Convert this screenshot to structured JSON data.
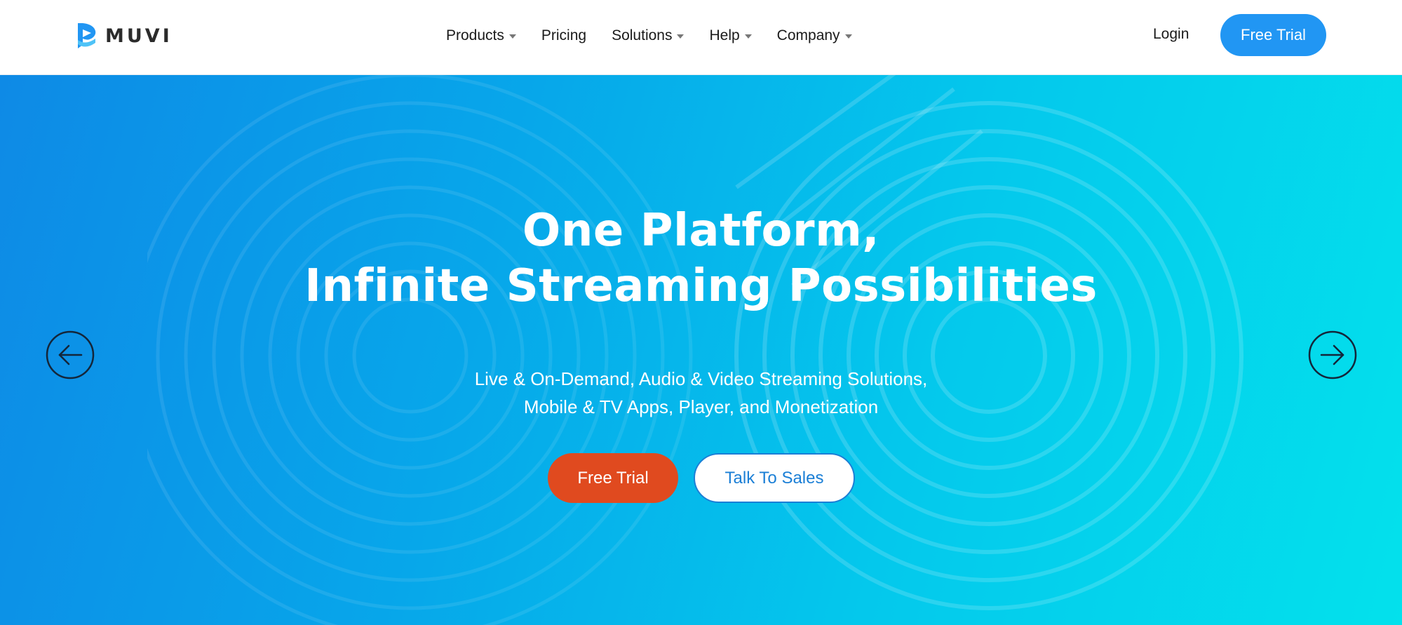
{
  "brand": {
    "name": "MUVI",
    "logo_icon": "muvi-logo-icon",
    "color": "#2196f3"
  },
  "nav": {
    "items": [
      {
        "label": "Products",
        "has_dropdown": true
      },
      {
        "label": "Pricing",
        "has_dropdown": false
      },
      {
        "label": "Solutions",
        "has_dropdown": true
      },
      {
        "label": "Help",
        "has_dropdown": true
      },
      {
        "label": "Company",
        "has_dropdown": true
      }
    ],
    "login_label": "Login",
    "free_trial_label": "Free Trial"
  },
  "hero": {
    "headline_line1": "One Platform,",
    "headline_line2": "Infinite Streaming Possibilities",
    "subline_line1": "Live & On-Demand, Audio & Video Streaming Solutions,",
    "subline_line2": "Mobile & TV Apps, Player, and Monetization",
    "cta_primary": "Free Trial",
    "cta_secondary": "Talk To Sales",
    "prev_icon": "arrow-left-icon",
    "next_icon": "arrow-right-icon"
  },
  "colors": {
    "accent": "#2196f3",
    "cta_primary": "#e04a1f",
    "cta_secondary_text": "#1b7fd6",
    "hero_gradient_start": "#0e8ae6",
    "hero_gradient_end": "#03e1ec"
  }
}
